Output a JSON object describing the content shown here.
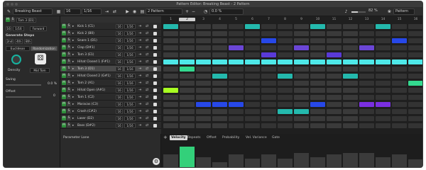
{
  "window": {
    "title": "Pattern Editor: Breaking Beast - 2 Pattern"
  },
  "toolbar": {
    "kit_name": "Breaking Beast",
    "step_count": "16",
    "resolution": "1/16",
    "pattern_name": "2 Pattern",
    "swing_value": "0.0 %",
    "zoom_value": "82 %",
    "view_label": "Pattern"
  },
  "inspector": {
    "lane_name": "Tom 3 (D1)",
    "count": "16",
    "resolution": "1/16",
    "direction": "Forward",
    "generate_title": "Generate Steps",
    "gen_buttons": [
      "2nd",
      "4th",
      "8th"
    ],
    "mode_tabs": [
      "Euclidean",
      "Randomization"
    ],
    "knob_labels": [
      "Density",
      "Mid Tom"
    ],
    "swing_label": "Swing",
    "swing_value": "0.0 %",
    "offset_label": "Offset",
    "offset_value": "0"
  },
  "lanes": [
    {
      "name": "Kick 1 (C1)",
      "len": "16",
      "res": "1/16"
    },
    {
      "name": "Kick 2 (B0)",
      "len": "16",
      "res": "1/16"
    },
    {
      "name": "Snare 1 (D1)",
      "len": "16",
      "res": "1/16"
    },
    {
      "name": "Clap (D#1)",
      "len": "16",
      "res": "1/16"
    },
    {
      "name": "Tom 3 (E1)",
      "len": "16",
      "res": "1/16"
    },
    {
      "name": "Hihat Closed 1 (F#1)",
      "len": "16",
      "res": "1/16"
    },
    {
      "name": "Tom 3 (D1)",
      "len": "16",
      "res": "1/16"
    },
    {
      "name": "Hihat Closed 2 (G#1)",
      "len": "16",
      "res": "1/16"
    },
    {
      "name": "Tom 2 (A1)",
      "len": "16",
      "res": "1/16"
    },
    {
      "name": "Hihat Open (A#1)",
      "len": "16",
      "res": "1/16"
    },
    {
      "name": "Tom 1 (C2)",
      "len": "16",
      "res": "1/16"
    },
    {
      "name": "Maracas (C3)",
      "len": "16",
      "res": "1/16"
    },
    {
      "name": "Crash (C#2)",
      "len": "16",
      "res": "1/16"
    },
    {
      "name": "Laser (D2)",
      "len": "16",
      "res": "1/16"
    },
    {
      "name": "Bass (D#2)",
      "len": "16",
      "res": "1/16"
    }
  ],
  "lane_buttons": {
    "mute": "M",
    "solo": "S"
  },
  "grid": {
    "columns": [
      "1",
      "2",
      "3",
      "4",
      "5",
      "6",
      "7",
      "8",
      "9",
      "10",
      "11",
      "12",
      "13",
      "14",
      "15",
      "16"
    ],
    "colors": {
      "teal": "#24b9ad",
      "cyan": "#4ee8e8",
      "purple": "#6b46d6",
      "blue": "#2748e8",
      "green": "#33d98f",
      "lime": "#a8ff22",
      "violet": "#5a3ad8",
      "magenta": "#7a2fe0"
    },
    "notes": [
      {
        "row": 0,
        "cols": [
          0,
          5,
          9,
          13
        ],
        "color": "teal"
      },
      {
        "row": 2,
        "cols": [
          6,
          14
        ],
        "color": "blue"
      },
      {
        "row": 3,
        "cols": [
          4,
          8,
          12
        ],
        "color": "purple"
      },
      {
        "row": 4,
        "cols": [
          6,
          10
        ],
        "color": "violet"
      },
      {
        "row": 5,
        "cols": [
          0,
          1,
          2,
          3,
          4,
          5,
          6,
          7,
          8,
          9,
          10,
          11,
          12,
          13,
          14,
          15
        ],
        "color": "cyan"
      },
      {
        "row": 6,
        "cols": [
          1
        ],
        "color": "green"
      },
      {
        "row": 7,
        "cols": [
          3,
          7,
          11
        ],
        "color": "teal"
      },
      {
        "row": 8,
        "cols": [
          15
        ],
        "color": "green"
      },
      {
        "row": 9,
        "cols": [
          0
        ],
        "color": "lime"
      },
      {
        "row": 11,
        "cols": [
          2,
          3,
          4,
          9
        ],
        "color": "blue"
      },
      {
        "row": 11,
        "cols": [
          12,
          13
        ],
        "color": "magenta"
      },
      {
        "row": 12,
        "cols": [
          7,
          8
        ],
        "color": "teal"
      }
    ]
  },
  "param_lane": {
    "label": "Parameter Lane",
    "tabs": [
      "Velocity",
      "Repeats",
      "Offset",
      "Probability",
      "Vel. Variance",
      "Gate"
    ],
    "active_tab": "Velocity",
    "highlight_color": "#33d07a",
    "velocities": [
      0.55,
      0.85,
      0.45,
      0.25,
      0.55,
      0.4,
      0.55,
      0.4,
      0.6,
      0.45,
      0.55,
      0.6,
      0.6,
      0.45,
      0.55,
      0.35
    ],
    "selected_step": 1
  }
}
